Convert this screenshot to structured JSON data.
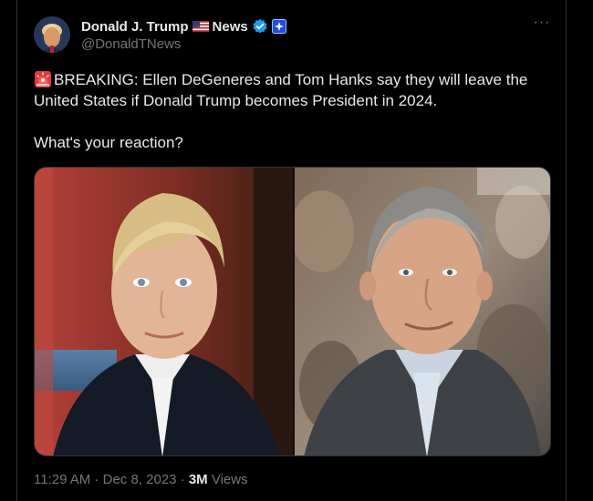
{
  "tweet": {
    "author": {
      "display_name": "Donald J. Trump",
      "name_suffix": "News",
      "handle": "@DonaldTNews",
      "flag_icon": "us-flag-icon",
      "verified_icon": "verified-badge-icon",
      "affiliate_icon": "affiliate-badge-icon"
    },
    "more_label": "···",
    "text_line_1": "BREAKING: Ellen DeGeneres and Tom Hanks say they will leave the United States if Donald Trump becomes President in 2024.",
    "text_line_2": "What's your reaction?",
    "leading_icon": "siren-icon",
    "meta": {
      "time": "11:29 AM",
      "separator": "·",
      "date": "Dec 8, 2023",
      "views_count": "3M",
      "views_label": "Views"
    }
  },
  "colors": {
    "background": "#000000",
    "text": "#e7e9ea",
    "secondary": "#71767b",
    "verified_blue": "#1d9bf0",
    "border": "#2f3336"
  }
}
